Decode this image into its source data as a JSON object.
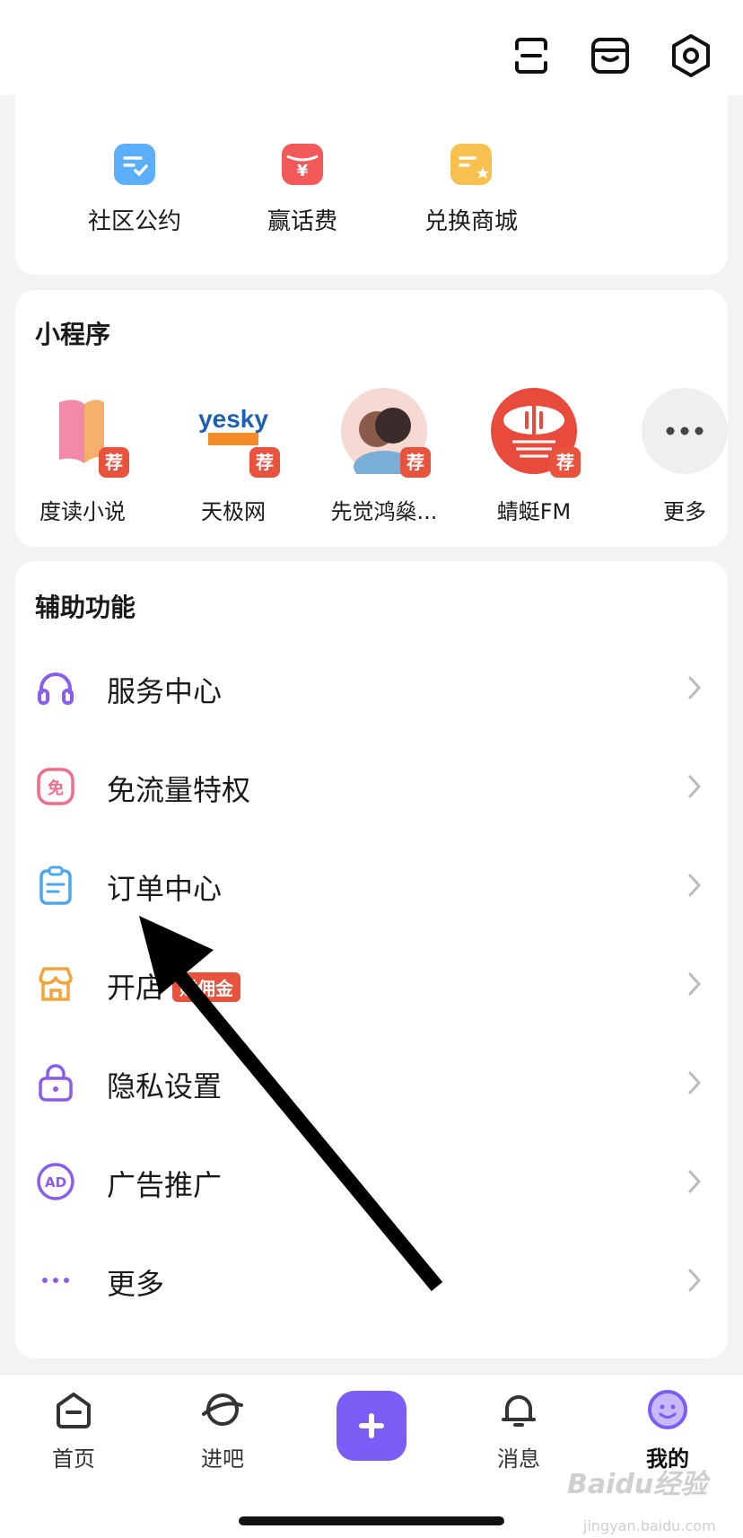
{
  "topbar": {
    "icons": [
      "scan-icon",
      "store-icon",
      "settings-icon"
    ]
  },
  "features": {
    "items": [
      {
        "label": "社区公约",
        "icon": "community-rules-icon",
        "color": "#5aaefc"
      },
      {
        "label": "赢话费",
        "icon": "phone-fee-icon",
        "color": "#f25a5a"
      },
      {
        "label": "兑换商城",
        "icon": "exchange-mall-icon",
        "color": "#f8c04e"
      }
    ]
  },
  "mini_programs": {
    "title": "小程序",
    "badge": "荐",
    "items": [
      {
        "label": "度读小说"
      },
      {
        "label": "天极网"
      },
      {
        "label": "先觉鸿燊..."
      },
      {
        "label": "蜻蜓FM"
      },
      {
        "label": "更多"
      }
    ]
  },
  "aux": {
    "title": "辅助功能",
    "items": [
      {
        "label": "服务中心",
        "icon": "headphones-icon"
      },
      {
        "label": "免流量特权",
        "icon": "free-data-icon",
        "icon_text": "免"
      },
      {
        "label": "订单中心",
        "icon": "clipboard-icon"
      },
      {
        "label": "开店",
        "icon": "shop-icon",
        "tag": "赚佣金"
      },
      {
        "label": "隐私设置",
        "icon": "lock-icon"
      },
      {
        "label": "广告推广",
        "icon": "ad-icon",
        "icon_text": "AD"
      },
      {
        "label": "更多",
        "icon": "more-dots-icon"
      }
    ]
  },
  "tabs": {
    "items": [
      {
        "label": "首页"
      },
      {
        "label": "进吧"
      },
      {
        "label": "消息"
      },
      {
        "label": "我的"
      }
    ],
    "active": "我的"
  },
  "colors": {
    "accent": "#7b5cf5",
    "badge": "#e8533d",
    "background": "#f3f3f5"
  },
  "watermark": {
    "main": "Baidu经验",
    "sub": "jingyan.baidu.com"
  }
}
